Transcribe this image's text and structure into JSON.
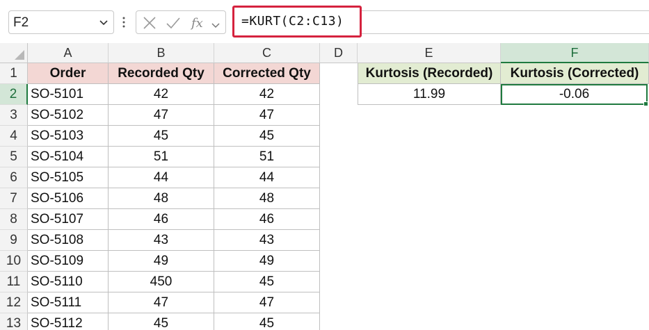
{
  "formula_bar": {
    "name_box": "F2",
    "formula": "=KURT(C2:C13)"
  },
  "icons": {
    "name_box_dropdown": "chevron-down-icon",
    "more": "vertical-dots-icon",
    "cancel": "x-icon",
    "enter": "checkmark-icon",
    "insert_function": "fx-icon",
    "expand": "chevron-down-icon"
  },
  "colors": {
    "header_pink": "#f3d7d4",
    "header_green": "#e2ecd2",
    "selection_green": "#1f7a3f",
    "formula_highlight": "#d5223e"
  },
  "columns": [
    "A",
    "B",
    "C",
    "D",
    "E",
    "F"
  ],
  "rows": [
    "1",
    "2",
    "3",
    "4",
    "5",
    "6",
    "7",
    "8",
    "9",
    "10",
    "11",
    "12",
    "13"
  ],
  "table": {
    "headers": [
      "Order",
      "Recorded Qty",
      "Corrected Qty"
    ],
    "data": [
      [
        "SO-5101",
        "42",
        "42"
      ],
      [
        "SO-5102",
        "47",
        "47"
      ],
      [
        "SO-5103",
        "45",
        "45"
      ],
      [
        "SO-5104",
        "51",
        "51"
      ],
      [
        "SO-5105",
        "44",
        "44"
      ],
      [
        "SO-5106",
        "48",
        "48"
      ],
      [
        "SO-5107",
        "46",
        "46"
      ],
      [
        "SO-5108",
        "43",
        "43"
      ],
      [
        "SO-5109",
        "49",
        "49"
      ],
      [
        "SO-5110",
        "450",
        "45"
      ],
      [
        "SO-5111",
        "47",
        "47"
      ],
      [
        "SO-5112",
        "45",
        "45"
      ]
    ]
  },
  "results": {
    "headers": [
      "Kurtosis (Recorded)",
      "Kurtosis (Corrected)"
    ],
    "values": [
      "11.99",
      "-0.06"
    ]
  }
}
